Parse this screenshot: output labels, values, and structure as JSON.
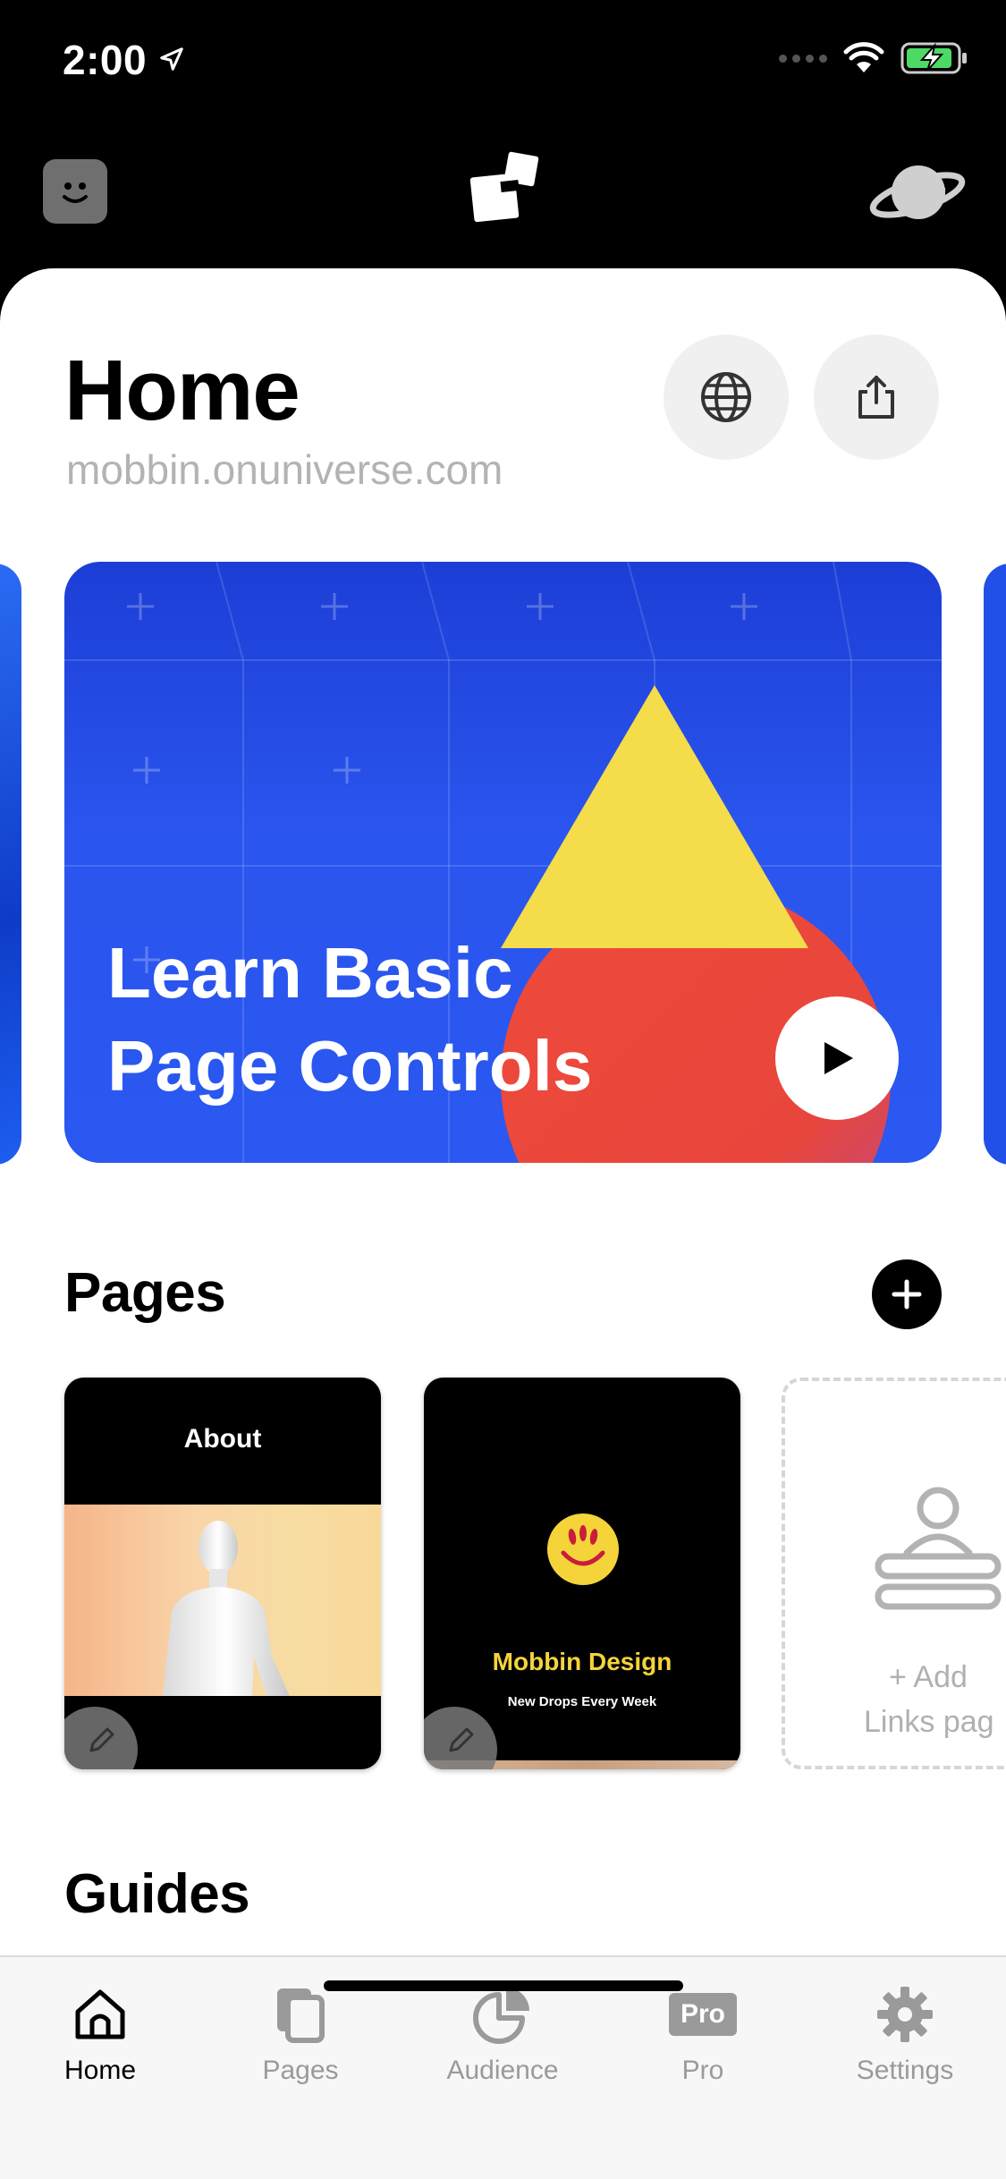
{
  "status_bar": {
    "time": "2:00"
  },
  "header": {
    "title": "Home",
    "url": "mobbin.onuniverse.com"
  },
  "hero": {
    "title_line1": "Learn Basic",
    "title_line2": "Page Controls"
  },
  "pages_section": {
    "title": "Pages",
    "cards": [
      {
        "label": "About"
      },
      {
        "name": "Mobbin Design",
        "tagline": "New Drops Every Week"
      }
    ],
    "add_card": {
      "line1": "+ Add",
      "line2": "Links pag"
    }
  },
  "guides_section": {
    "title": "Guides"
  },
  "tab_bar": {
    "tabs": [
      {
        "label": "Home",
        "icon": "home-icon",
        "active": true
      },
      {
        "label": "Pages",
        "icon": "pages-icon",
        "active": false
      },
      {
        "label": "Audience",
        "icon": "pie-chart-icon",
        "active": false
      },
      {
        "label": "Pro",
        "icon": "pro-badge-icon",
        "badge": "Pro",
        "active": false
      },
      {
        "label": "Settings",
        "icon": "gear-icon",
        "active": false
      }
    ]
  },
  "colors": {
    "hero_blue": "#2a55ee",
    "hero_triangle": "#f5dc4a",
    "hero_circle": "#e8463c",
    "mobbin_yellow": "#f5d43a",
    "inactive_gray": "#9a9a9a"
  }
}
